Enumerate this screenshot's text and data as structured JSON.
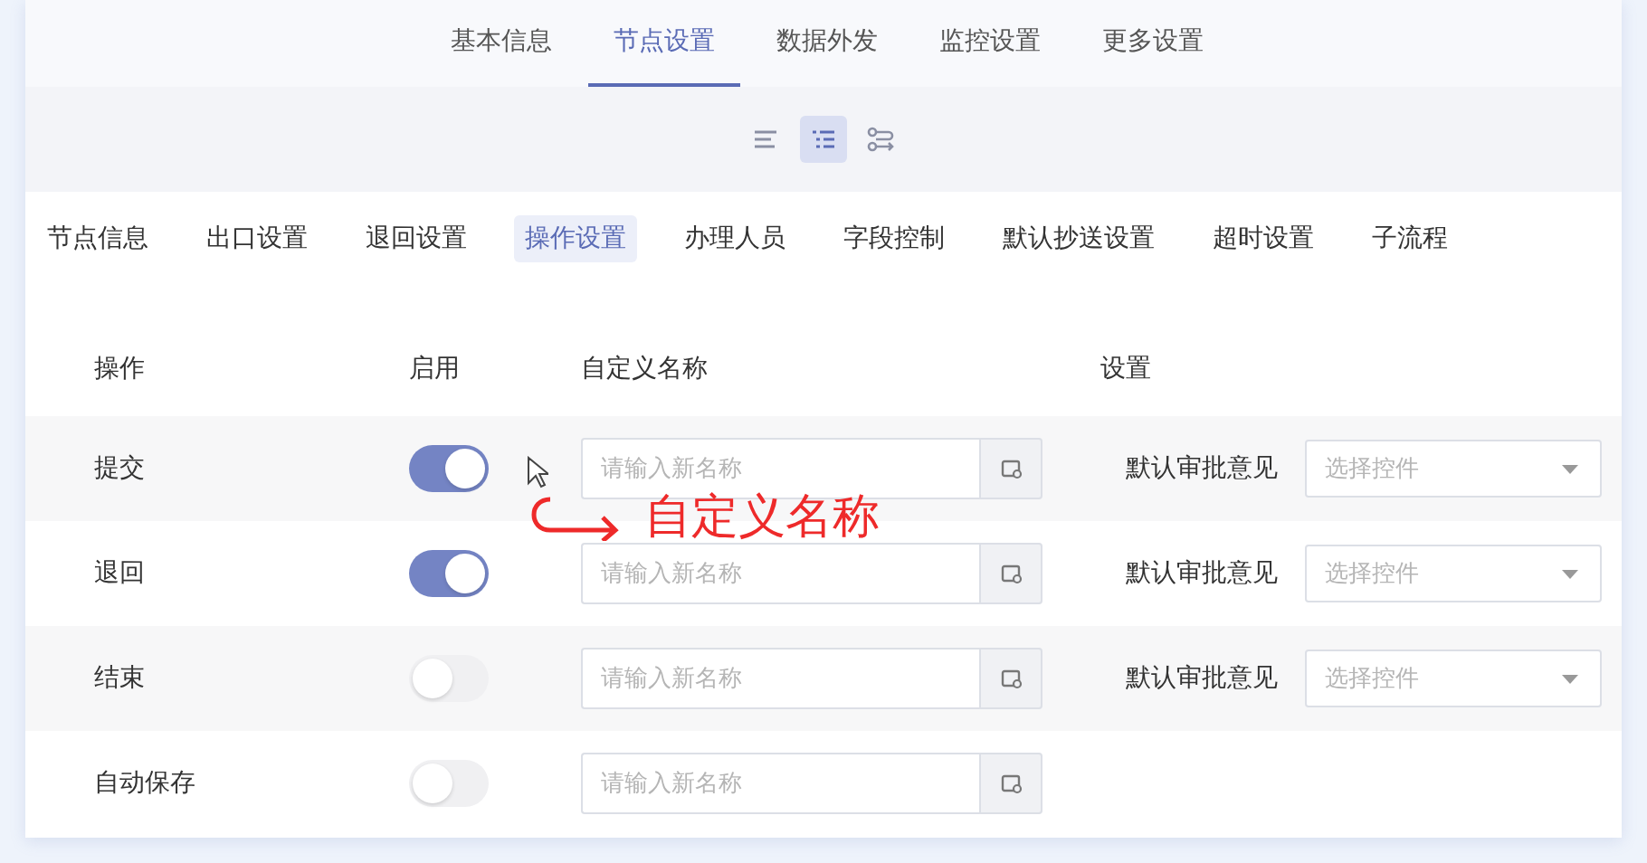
{
  "top_tabs": [
    {
      "label": "基本信息",
      "selected": false
    },
    {
      "label": "节点设置",
      "selected": true
    },
    {
      "label": "数据外发",
      "selected": false
    },
    {
      "label": "监控设置",
      "selected": false
    },
    {
      "label": "更多设置",
      "selected": false
    }
  ],
  "view_toggles": [
    {
      "kind": "text",
      "selected": false
    },
    {
      "kind": "list",
      "selected": true
    },
    {
      "kind": "flow",
      "selected": false
    }
  ],
  "sub_tabs": [
    {
      "label": "节点信息",
      "selected": false
    },
    {
      "label": "出口设置",
      "selected": false
    },
    {
      "label": "退回设置",
      "selected": false
    },
    {
      "label": "操作设置",
      "selected": true
    },
    {
      "label": "办理人员",
      "selected": false
    },
    {
      "label": "字段控制",
      "selected": false
    },
    {
      "label": "默认抄送设置",
      "selected": false
    },
    {
      "label": "超时设置",
      "selected": false
    },
    {
      "label": "子流程",
      "selected": false
    }
  ],
  "table": {
    "columns": [
      "操作",
      "启用",
      "自定义名称",
      "设置"
    ],
    "rows": [
      {
        "action": "提交",
        "on": true,
        "placeholder": "请输入新名称",
        "setting_label": "默认审批意见",
        "select_placeholder": "选择控件"
      },
      {
        "action": "退回",
        "on": true,
        "placeholder": "请输入新名称",
        "setting_label": "默认审批意见",
        "select_placeholder": "选择控件"
      },
      {
        "action": "结束",
        "on": false,
        "placeholder": "请输入新名称",
        "setting_label": "默认审批意见",
        "select_placeholder": "选择控件"
      },
      {
        "action": "自动保存",
        "on": false,
        "placeholder": "请输入新名称"
      }
    ]
  },
  "annotation": {
    "text": "自定义名称"
  }
}
